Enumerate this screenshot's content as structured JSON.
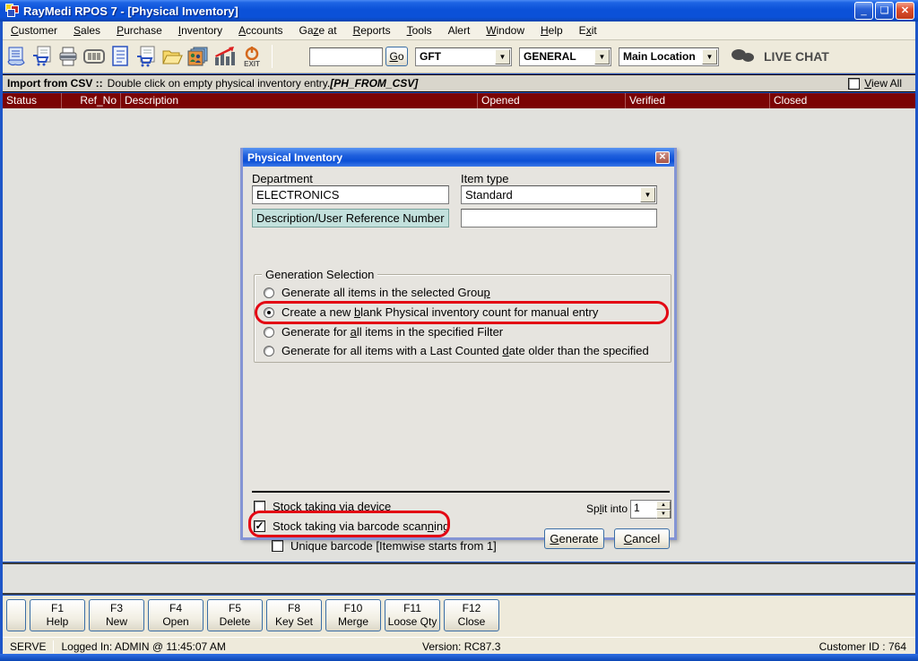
{
  "window": {
    "title": "RayMedi RPOS 7 - [Physical Inventory]",
    "controls": {
      "minimize": "_",
      "restore": "❏",
      "close": "✕"
    }
  },
  "menu": {
    "items": [
      {
        "label": "Customer",
        "accel": 0
      },
      {
        "label": "Sales",
        "accel": 0
      },
      {
        "label": "Purchase",
        "accel": 0
      },
      {
        "label": "Inventory",
        "accel": 0
      },
      {
        "label": "Accounts",
        "accel": 0
      },
      {
        "label": "Gaze at",
        "accel": 2
      },
      {
        "label": "Reports",
        "accel": 0
      },
      {
        "label": "Tools",
        "accel": 0
      },
      {
        "label": "Alert",
        "accel": null
      },
      {
        "label": "Window",
        "accel": 0
      },
      {
        "label": "Help",
        "accel": 0
      },
      {
        "label": "Exit",
        "accel": 1
      }
    ]
  },
  "toolbar": {
    "icons": [
      "billing-icon",
      "sales-cart-icon",
      "printer-icon",
      "barcode-icon",
      "document-icon",
      "purchase-cart-icon",
      "folder-open-icon",
      "gallery-icon",
      "chart-icon"
    ],
    "exit_label": "EXIT",
    "search_value": "",
    "go_button": {
      "label": "Go",
      "accel": 0
    },
    "combo_company": "GFT",
    "combo_group": "GENERAL",
    "combo_location": "Main Location",
    "live_chat_label": "LIVE CHAT"
  },
  "import_bar": {
    "title": "Import from CSV ::",
    "text": "Double click on empty physical inventory entry.",
    "tag": "[PH_FROM_CSV]",
    "view_all": {
      "label": "View All",
      "accel": 0,
      "checked": false
    }
  },
  "table": {
    "columns": [
      "Status",
      "Ref_No",
      "Description",
      "Opened",
      "Verified",
      "Closed"
    ],
    "rows": []
  },
  "dialog": {
    "title": "Physical Inventory",
    "close_glyph": "✕",
    "department_label": "Department",
    "department_value": "ELECTRONICS",
    "item_type_label": "Item type",
    "item_type_value": "Standard",
    "reference_label": "Description/User Reference Number",
    "reference_value": "",
    "generation": {
      "legend": "Generation Selection",
      "options": [
        {
          "label": "Generate all items in the selected Group",
          "accel": 39,
          "selected": false,
          "annotated": false
        },
        {
          "label": "Create a new blank Physical inventory count for manual entry",
          "accel": 13,
          "selected": true,
          "annotated": true
        },
        {
          "label": "Generate for all items in the specified Filter",
          "accel": 13,
          "selected": false,
          "annotated": false
        },
        {
          "label": "Generate for all items with a Last Counted date older than the specified",
          "accel": 43,
          "selected": false,
          "annotated": false
        }
      ]
    },
    "stock_device": {
      "label": "Stock taking via device",
      "accel": 0,
      "checked": false
    },
    "split_into": {
      "label": "Split into",
      "accel": 2,
      "value": "1"
    },
    "stock_barcode": {
      "label": "Stock taking via barcode scanning",
      "accel": 29,
      "checked": true,
      "annotated": true
    },
    "unique_barcode": {
      "label": "Unique barcode [Itemwise starts from 1]",
      "accel": null,
      "checked": false
    },
    "generate_button": {
      "label": "Generate",
      "accel": 0
    },
    "cancel_button": {
      "label": "Cancel",
      "accel": 0
    },
    "check_glyph": "✓"
  },
  "function_keys": [
    {
      "key": "F1",
      "label": "Help"
    },
    {
      "key": "F3",
      "label": "New"
    },
    {
      "key": "F4",
      "label": "Open"
    },
    {
      "key": "F5",
      "label": "Delete"
    },
    {
      "key": "F8",
      "label": "Key Set"
    },
    {
      "key": "F10",
      "label": "Merge"
    },
    {
      "key": "F11",
      "label": "Loose Qty"
    },
    {
      "key": "F12",
      "label": "Close"
    }
  ],
  "status_bar": {
    "server": "SERVE",
    "logged_in": "Logged In: ADMIN  @ 11:45:07 AM",
    "version": "Version: RC87.3",
    "customer_id": "Customer ID : 764"
  }
}
